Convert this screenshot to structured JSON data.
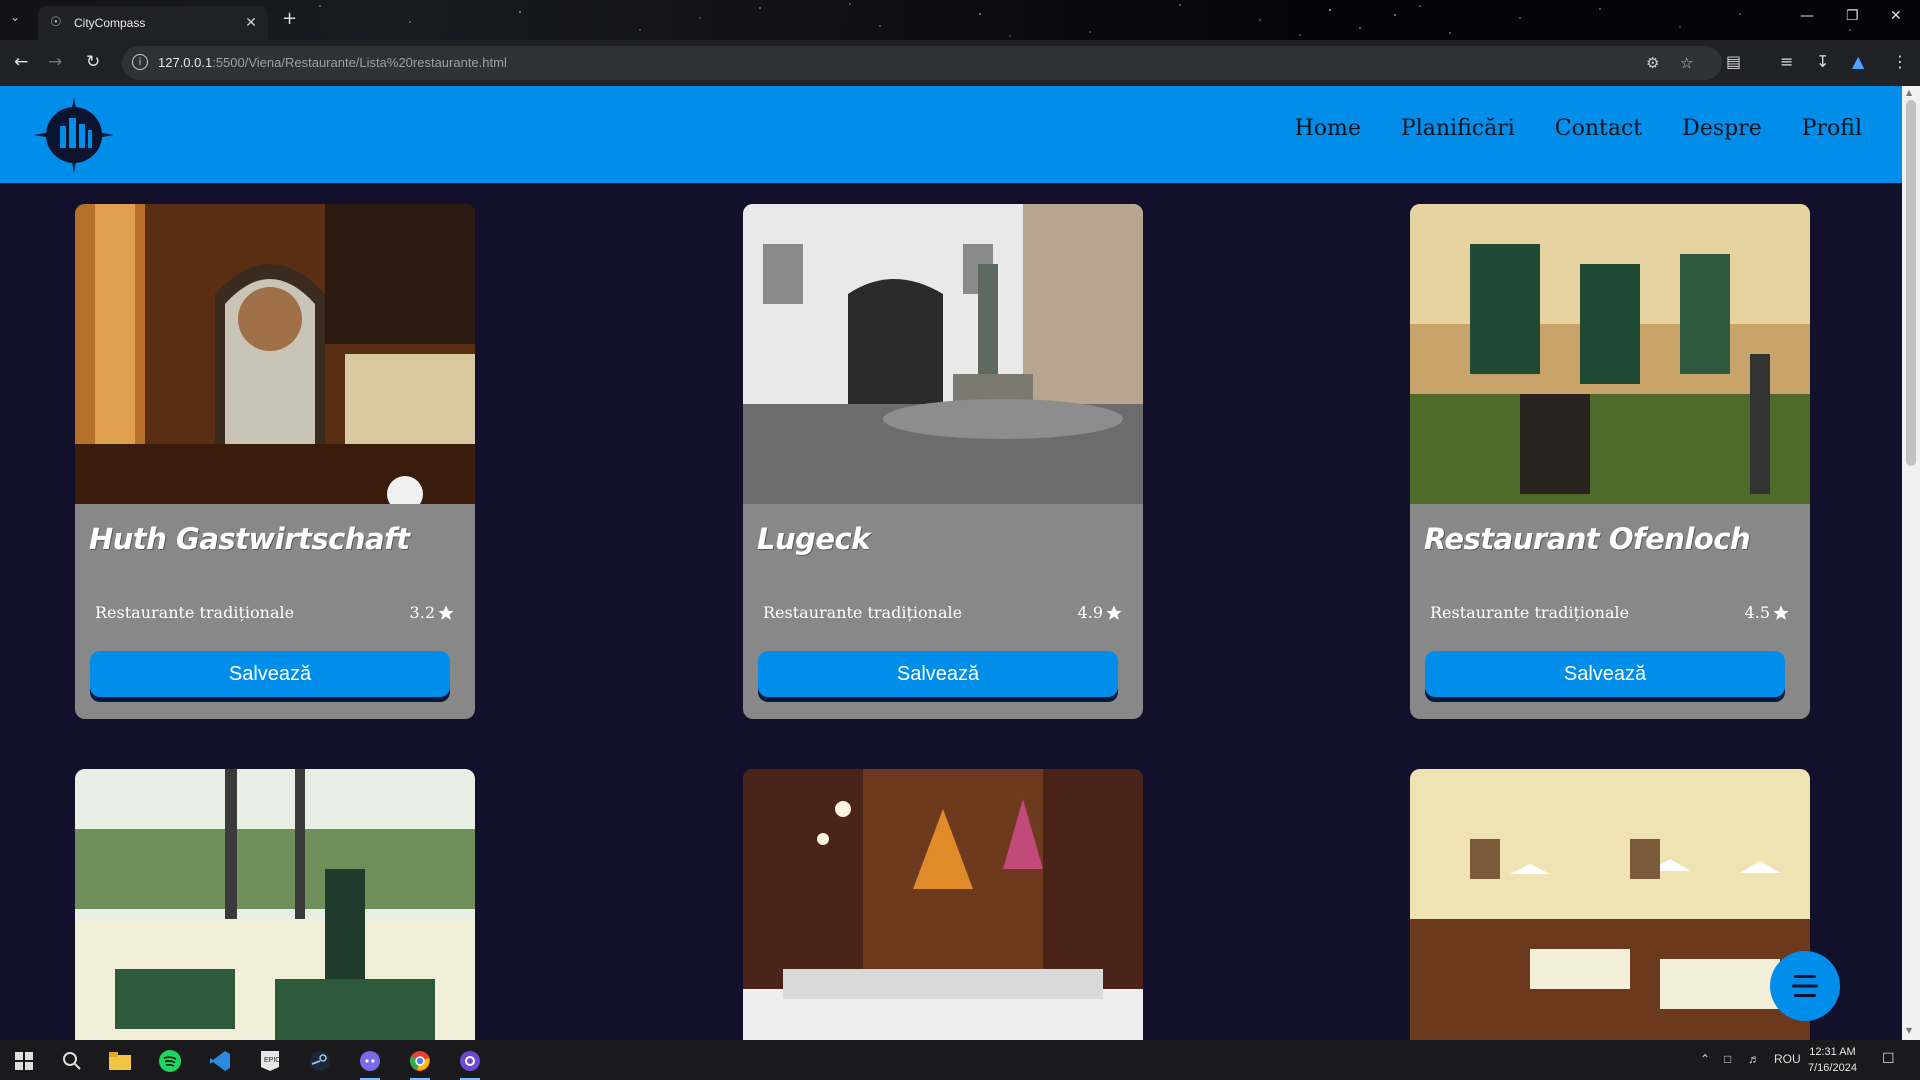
{
  "browser": {
    "tab_title": "CityCompass",
    "url_host": "127.0.0.1",
    "url_rest": ":5500/Viena/Restaurante/Lista%20restaurante.html"
  },
  "nav": {
    "items": [
      "Home",
      "Planificări",
      "Contact",
      "Despre",
      "Profil"
    ]
  },
  "cards": [
    {
      "name": "Huth Gastwirtschaft",
      "category": "Restaurante tradiționale",
      "rating": "3.2",
      "button": "Salvează"
    },
    {
      "name": "Lugeck",
      "category": "Restaurante tradiționale",
      "rating": "4.9",
      "button": "Salvează"
    },
    {
      "name": "Restaurant Ofenloch",
      "category": "Restaurante tradiționale",
      "rating": "4.5",
      "button": "Salvează"
    }
  ],
  "taskbar": {
    "language": "ROU",
    "time": "12:31 AM",
    "date": "7/16/2024"
  },
  "colors": {
    "accent": "#008eea",
    "page_bg": "#13102b",
    "card_bg": "#888888"
  }
}
